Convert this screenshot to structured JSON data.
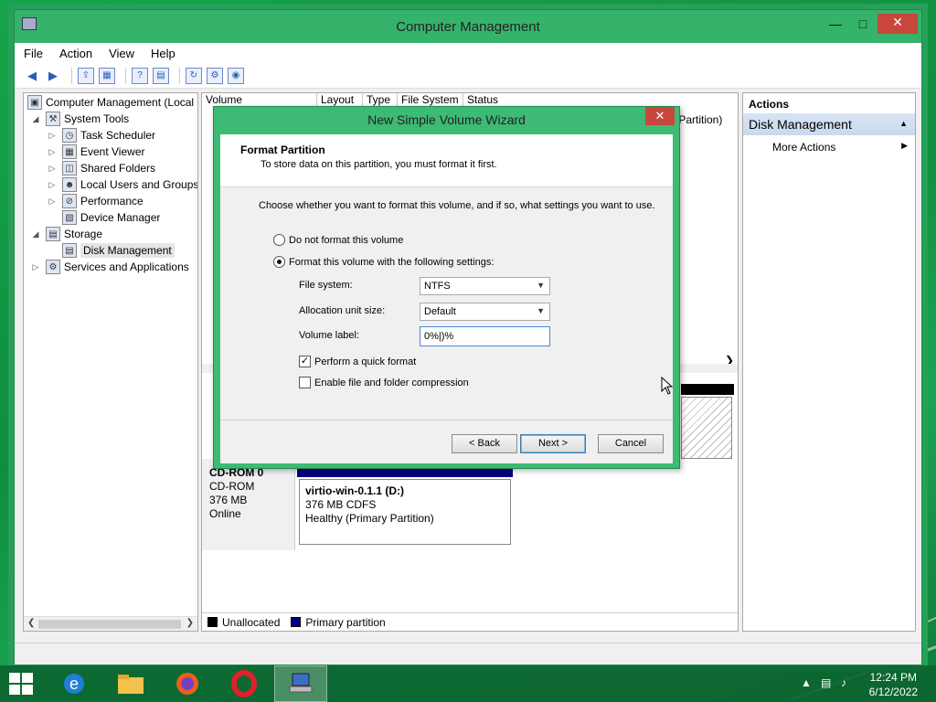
{
  "window": {
    "title": "Computer Management"
  },
  "menu": [
    "File",
    "Action",
    "View",
    "Help"
  ],
  "tree": {
    "root": "Computer Management (Local",
    "system_tools": "System Tools",
    "task_scheduler": "Task Scheduler",
    "event_viewer": "Event Viewer",
    "shared_folders": "Shared Folders",
    "local_users": "Local Users and Groups",
    "performance": "Performance",
    "device_manager": "Device Manager",
    "storage": "Storage",
    "disk_management": "Disk Management",
    "services": "Services and Applications"
  },
  "volume_list": {
    "columns": [
      "Volume",
      "Layout",
      "Type",
      "File System",
      "Status"
    ],
    "partial_status": "ry Partition)"
  },
  "disk": {
    "name": "CD-ROM 0",
    "type": "CD-ROM",
    "size": "376 MB",
    "state": "Online",
    "partition_name": "virtio-win-0.1.1  (D:)",
    "partition_size": "376 MB CDFS",
    "partition_status": "Healthy (Primary Partition)"
  },
  "legend": {
    "unallocated": "Unallocated",
    "primary": "Primary partition"
  },
  "actions": {
    "header": "Actions",
    "section": "Disk Management",
    "more": "More Actions"
  },
  "wizard": {
    "title": "New Simple Volume Wizard",
    "heading": "Format Partition",
    "subheading": "To store data on this partition, you must format it first.",
    "intro": "Choose whether you want to format this volume, and if so, what settings you want to use.",
    "opt_no_format": "Do not format this volume",
    "opt_format": "Format this volume with the following settings:",
    "fs_label": "File system:",
    "fs_value": "NTFS",
    "alloc_label": "Allocation unit size:",
    "alloc_value": "Default",
    "vol_label": "Volume label:",
    "vol_value": "0%|)%",
    "quick_format": "Perform a quick format",
    "compression": "Enable file and folder compression",
    "btn_back": "< Back",
    "btn_next": "Next >",
    "btn_cancel": "Cancel"
  },
  "clock": {
    "time": "12:24 PM",
    "date": "6/12/2022"
  },
  "colors": {
    "accent_green": "#35b36a",
    "primary_partition": "#000080",
    "close_red": "#c9463d"
  }
}
